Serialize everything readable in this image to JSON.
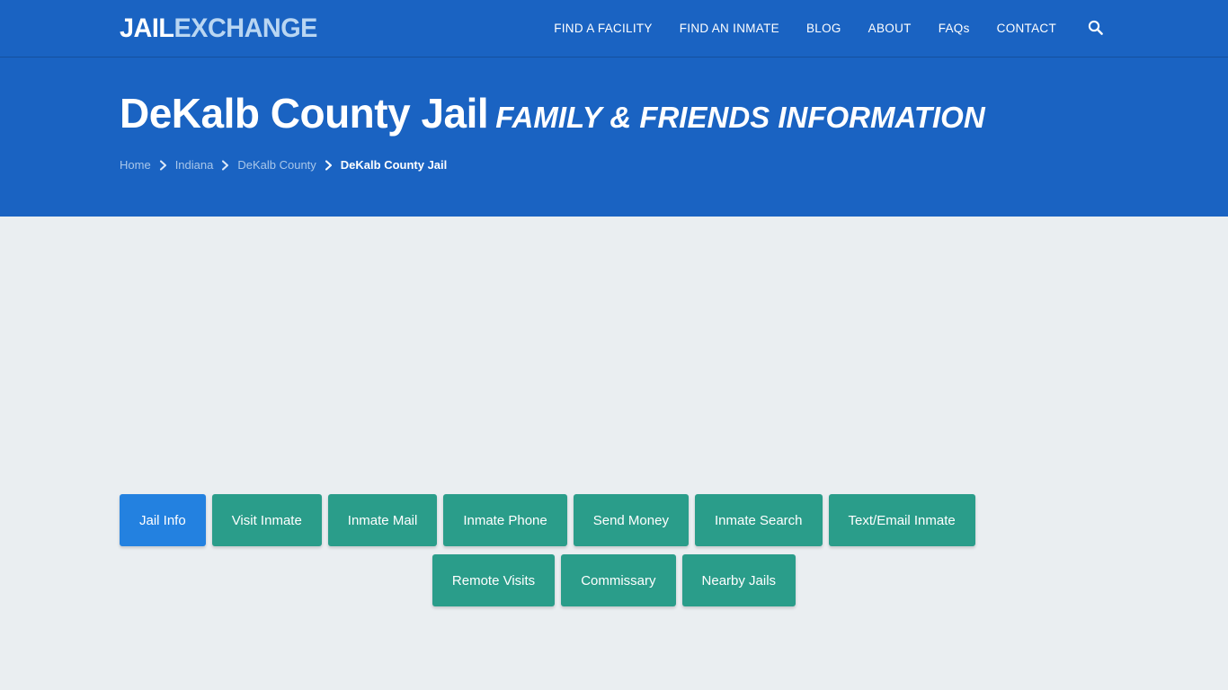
{
  "colors": {
    "header_blue": "#1a63c2",
    "active_button_blue": "#2381e0",
    "button_teal": "#2a9d8a",
    "page_background": "#eaeef1",
    "logo_accent": "#b9d6f2",
    "breadcrumb_link": "#a9c7ea"
  },
  "header": {
    "logo": {
      "part_a": "JAIL",
      "part_b": "EXCHANGE"
    },
    "nav": [
      {
        "label": "FIND A FACILITY"
      },
      {
        "label": "FIND AN INMATE"
      },
      {
        "label": "BLOG"
      },
      {
        "label": "ABOUT"
      },
      {
        "label": "FAQs"
      },
      {
        "label": "CONTACT"
      }
    ],
    "search_icon": "search-icon"
  },
  "hero": {
    "title_main": "DeKalb County Jail",
    "title_sub": "FAMILY & FRIENDS INFORMATION",
    "breadcrumb": {
      "separator_icon": "chevron-right-icon",
      "items": [
        {
          "label": "Home",
          "current": false
        },
        {
          "label": "Indiana",
          "current": false
        },
        {
          "label": "DeKalb County",
          "current": false
        },
        {
          "label": "DeKalb County Jail",
          "current": true
        }
      ]
    }
  },
  "main": {
    "tabs_row_1": [
      {
        "label": "Jail Info",
        "active": true
      },
      {
        "label": "Visit Inmate",
        "active": false
      },
      {
        "label": "Inmate Mail",
        "active": false
      },
      {
        "label": "Inmate Phone",
        "active": false
      },
      {
        "label": "Send Money",
        "active": false
      },
      {
        "label": "Inmate Search",
        "active": false
      },
      {
        "label": "Text/Email Inmate",
        "active": false
      }
    ],
    "tabs_row_2": [
      {
        "label": "Remote Visits",
        "active": false
      },
      {
        "label": "Commissary",
        "active": false
      },
      {
        "label": "Nearby Jails",
        "active": false
      }
    ]
  }
}
